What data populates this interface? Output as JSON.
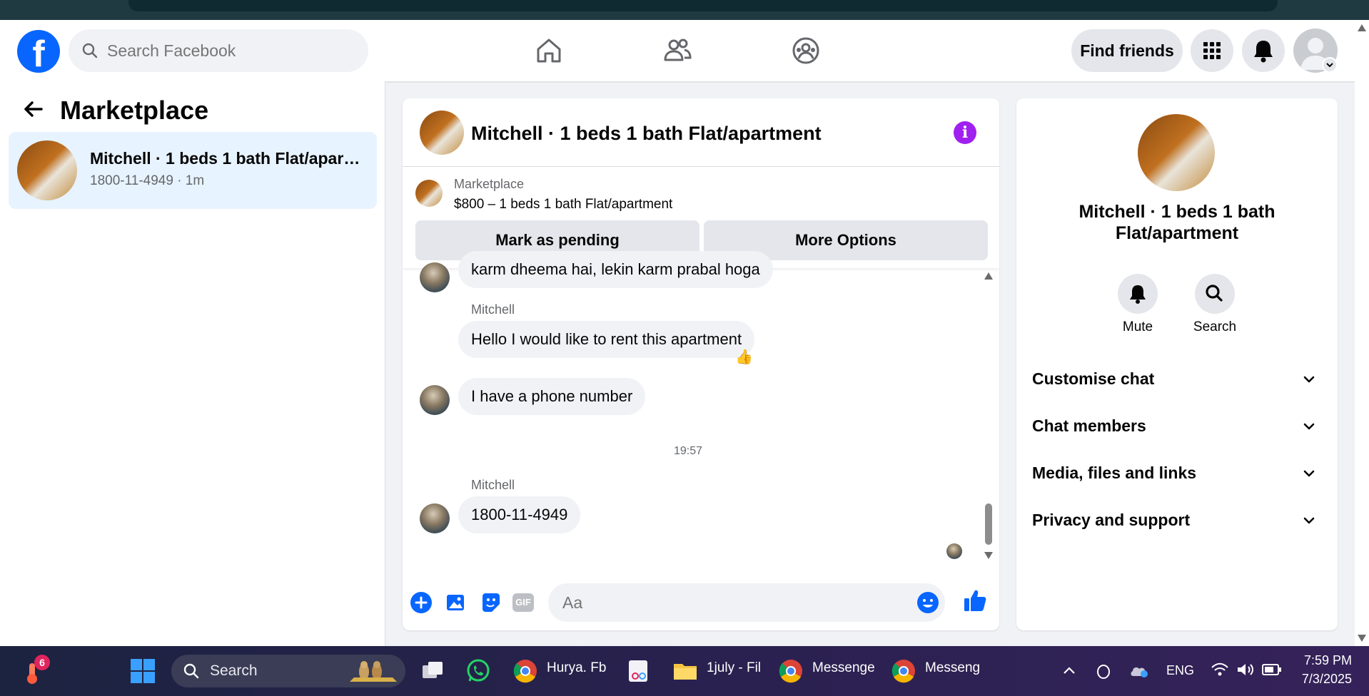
{
  "header": {
    "search_placeholder": "Search Facebook",
    "find_friends": "Find friends"
  },
  "left": {
    "title": "Marketplace",
    "listing": {
      "name": "Mitchell · 1 beds 1 bath Flat/apart...",
      "sub": "1800-11-4949 · 1m"
    }
  },
  "chat": {
    "title": "Mitchell · 1 beds 1 bath Flat/apartment",
    "banner": {
      "label": "Marketplace",
      "price": "$800 – 1 beds 1 bath Flat/apartment",
      "mark_pending": "Mark as pending",
      "more_options": "More Options"
    },
    "messages": {
      "m1": "karm dheema hai, lekin karm prabal hoga",
      "sender1": "Mitchell",
      "m2": "Hello I would like to rent this apartment",
      "m2_reaction": "👍",
      "m3": "I have a phone number",
      "timestamp": "19:57",
      "sender2": "Mitchell",
      "m4": "1800-11-4949"
    },
    "composer_placeholder": "Aa",
    "gif_label": "GIF"
  },
  "right": {
    "name": "Mitchell · 1 beds 1 bath Flat/apartment",
    "mute": "Mute",
    "search": "Search",
    "rows": [
      "Customise chat",
      "Chat members",
      "Media, files and links",
      "Privacy and support"
    ]
  },
  "taskbar": {
    "weather_badge": "6",
    "search": "Search",
    "app1": "Hurya. Fb",
    "app2": "1july - Fil",
    "app3": "Messenge",
    "app4": "Messenge",
    "lang": "ENG",
    "time": "7:59 PM",
    "date": "7/3/2025"
  },
  "colors": {
    "fb_blue": "#0866ff",
    "selected_bg": "#e7f3ff",
    "info_purple": "#a020f0",
    "composer_blue": "#0866ff"
  }
}
